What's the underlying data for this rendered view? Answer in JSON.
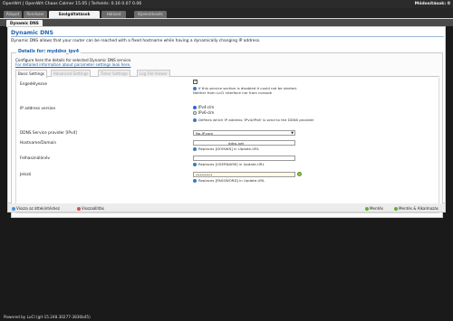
{
  "topbar": {
    "title": "OpenWrt | OpenWrt Chaos Calmer 15.05 | Terhelés: 0.16 0.07 0.06",
    "right": "Módosítások: 0"
  },
  "menu": {
    "tabs": [
      {
        "label": "Állapot"
      },
      {
        "label": "Rendszer"
      },
      {
        "label": "Szolgáltatások"
      },
      {
        "label": "Hálózat"
      },
      {
        "label": "Kijelentkezés"
      }
    ]
  },
  "submenu": {
    "active": "Dynamic DNS"
  },
  "page": {
    "title": "Dynamic DNS",
    "description": "Dynamic DNS allows that your router can be reached with a fixed hostname while having a dynamically changing IP address."
  },
  "details": {
    "legend": "Details for: myddns_ipv4",
    "description": "Configure here the details for selected Dynamic DNS service.",
    "link": "For detailed information about parameter settings look here.",
    "tabs": [
      {
        "label": "Basic Settings"
      },
      {
        "label": "Advanced Settings"
      },
      {
        "label": "Timer Settings"
      },
      {
        "label": "Log File Viewer"
      }
    ]
  },
  "form": {
    "enabled": {
      "label": "Engedélyezve",
      "checked": true,
      "help": "If this service section is disabled it could not be started.",
      "help2": "Neither from LuCI interface nor from console"
    },
    "ip_version": {
      "label": "IP address version",
      "options": [
        {
          "label": "IPv4-cím",
          "selected": true
        },
        {
          "label": "IPv6-cím",
          "selected": false
        }
      ],
      "help": "Defines which IP address 'IPv4/IPv6' is send to the DDNS provider"
    },
    "provider": {
      "label": "DDNS Service provider [IPv4]",
      "value": "No-IP.com"
    },
    "hostname": {
      "label": "Hostname/Domain",
      "value": "ddns.net",
      "help": "Replaces [DOMAIN] in Update-URL"
    },
    "username": {
      "label": "Felhasználónév",
      "value": "",
      "help": "Replaces [USERNAME] in Update-URL"
    },
    "password": {
      "label": "Jelszó",
      "value": "••••••••",
      "help": "Replaces [PASSWORD] in Update-URL"
    }
  },
  "footer": {
    "back": "Vissza az áttekintéshez",
    "reset": "Visszaállítás",
    "save": "Mentés",
    "save_apply": "Mentés & Alkalmazás"
  },
  "powered": "Powered by LuCI (git-15.248.30277-3836b45)"
}
